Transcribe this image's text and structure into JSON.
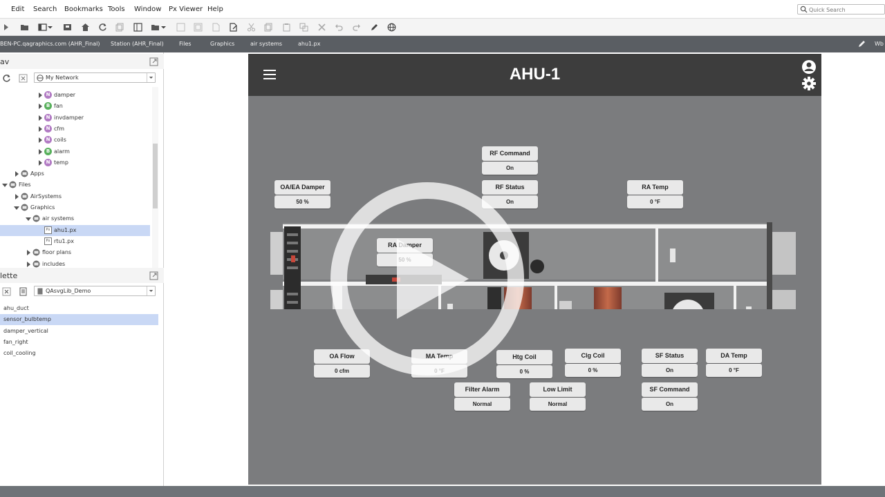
{
  "menubar": {
    "items": [
      "Edit",
      "Search",
      "Bookmarks",
      "Tools",
      "Window",
      "Px Viewer",
      "Help"
    ],
    "search_placeholder": "Quick Search"
  },
  "locbar": {
    "crumbs": [
      "BEN-PC.qagraphics.com (AHR_Final)",
      "Station (AHR_Final)",
      "Files",
      "Graphics",
      "air systems",
      "ahu1.px"
    ],
    "right_label": "Wb"
  },
  "nav": {
    "title": "av",
    "network_select": "My Network",
    "tree": [
      {
        "label": "damper",
        "badge": "N",
        "kind": "n",
        "indent": 4,
        "expandable": true
      },
      {
        "label": "fan",
        "badge": "B",
        "kind": "b",
        "indent": 4,
        "expandable": true
      },
      {
        "label": "invdamper",
        "badge": "N",
        "kind": "n",
        "indent": 4,
        "expandable": true
      },
      {
        "label": "cfm",
        "badge": "N",
        "kind": "n",
        "indent": 4,
        "expandable": true
      },
      {
        "label": "coils",
        "badge": "N",
        "kind": "n",
        "indent": 4,
        "expandable": true
      },
      {
        "label": "alarm",
        "badge": "B",
        "kind": "b",
        "indent": 4,
        "expandable": true
      },
      {
        "label": "temp",
        "badge": "N",
        "kind": "n",
        "indent": 4,
        "expandable": true
      },
      {
        "label": "Apps",
        "badge": "",
        "kind": "folder",
        "indent": 2,
        "expandable": true
      },
      {
        "label": "Files",
        "badge": "",
        "kind": "folder",
        "indent": 1,
        "expandable": true,
        "expanded": true
      },
      {
        "label": "AirSystems",
        "badge": "",
        "kind": "folder",
        "indent": 2,
        "expandable": true
      },
      {
        "label": "Graphics",
        "badge": "",
        "kind": "folder",
        "indent": 2,
        "expandable": true,
        "expanded": true
      },
      {
        "label": "air systems",
        "badge": "",
        "kind": "folder",
        "indent": 3,
        "expandable": true,
        "expanded": true
      },
      {
        "label": "ahu1.px",
        "badge": "Px",
        "kind": "px",
        "indent": 4,
        "expandable": false,
        "selected": true
      },
      {
        "label": "rtu1.px",
        "badge": "Px",
        "kind": "px",
        "indent": 4,
        "expandable": false
      },
      {
        "label": "floor plans",
        "badge": "",
        "kind": "folder",
        "indent": 3,
        "expandable": true
      },
      {
        "label": "includes",
        "badge": "",
        "kind": "folder",
        "indent": 3,
        "expandable": true
      }
    ]
  },
  "palette": {
    "title": "lette",
    "library_select": "QAsvgLib_Demo",
    "items": [
      {
        "label": "ahu_duct"
      },
      {
        "label": "sensor_bulbtemp",
        "selected": true
      },
      {
        "label": "damper_vertical"
      },
      {
        "label": "fan_right"
      },
      {
        "label": "coil_cooling"
      }
    ]
  },
  "graphic": {
    "title": "AHU-1",
    "points": {
      "rf_command": {
        "label": "RF Command",
        "value": "On"
      },
      "rf_status": {
        "label": "RF Status",
        "value": "On"
      },
      "oa_ea_damper": {
        "label": "OA/EA Damper",
        "value": "50 %"
      },
      "ra_temp": {
        "label": "RA Temp",
        "value": "0 °F"
      },
      "ra_damper": {
        "label": "RA Damper",
        "value": "50 %"
      },
      "oa_flow": {
        "label": "OA Flow",
        "value": "0 cfm"
      },
      "ma_temp": {
        "label": "MA Temp",
        "value": "0 °F"
      },
      "htg_coil": {
        "label": "Htg Coil",
        "value": "0 %"
      },
      "clg_coil": {
        "label": "Clg Coil",
        "value": "0 %"
      },
      "sf_status": {
        "label": "SF Status",
        "value": "On"
      },
      "da_temp": {
        "label": "DA Temp",
        "value": "0 °F"
      },
      "filter_alarm": {
        "label": "Filter Alarm",
        "value": "Normal"
      },
      "low_limit": {
        "label": "Low Limit",
        "value": "Normal"
      },
      "sf_command": {
        "label": "SF Command",
        "value": "On"
      }
    }
  },
  "colors": {
    "graphic_bg": "#7b7c7e",
    "graphic_header": "#3d3d3d",
    "locbar": "#5a5e63",
    "selection": "#c9d8f5"
  }
}
